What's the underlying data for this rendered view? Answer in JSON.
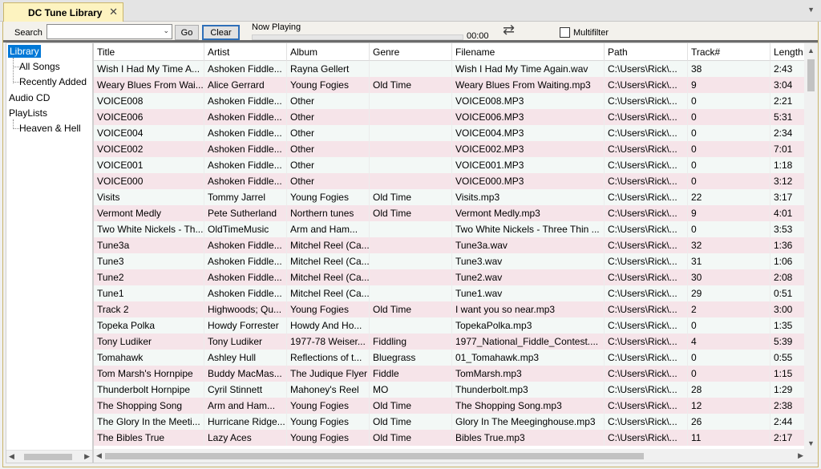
{
  "tab": {
    "title": "DC Tune Library",
    "close": "✕"
  },
  "toolbar": {
    "search_label": "Search",
    "search_value": "",
    "go_label": "Go",
    "clear_label": "Clear",
    "now_playing_label": "Now Playing",
    "progress": 0,
    "time": "00:00",
    "multifilter_label": "Multifilter",
    "multifilter_checked": false
  },
  "tree": {
    "library": "Library",
    "all_songs": "All Songs",
    "recently_added": "Recently Added",
    "audio_cd": "Audio CD",
    "playlists": "PlayLists",
    "heaven_hell": "Heaven & Hell"
  },
  "table": {
    "columns": [
      "Title",
      "Artist",
      "Album",
      "Genre",
      "Filename",
      "Path",
      "Track#",
      "Length"
    ],
    "rows": [
      [
        "Wish I Had My Time A...",
        "Ashoken Fiddle...",
        "Rayna Gellert",
        "",
        "Wish I Had My Time Again.wav",
        "C:\\Users\\Rick\\...",
        "38",
        "2:43"
      ],
      [
        "Weary Blues From Wai...",
        "Alice Gerrard",
        "Young Fogies",
        "Old Time",
        "Weary Blues From Waiting.mp3",
        "C:\\Users\\Rick\\...",
        "9",
        "3:04"
      ],
      [
        "VOICE008",
        "Ashoken Fiddle...",
        "Other",
        "",
        "VOICE008.MP3",
        "C:\\Users\\Rick\\...",
        "0",
        "2:21"
      ],
      [
        "VOICE006",
        "Ashoken Fiddle...",
        "Other",
        "",
        "VOICE006.MP3",
        "C:\\Users\\Rick\\...",
        "0",
        "5:31"
      ],
      [
        "VOICE004",
        "Ashoken Fiddle...",
        "Other",
        "",
        "VOICE004.MP3",
        "C:\\Users\\Rick\\...",
        "0",
        "2:34"
      ],
      [
        "VOICE002",
        "Ashoken Fiddle...",
        "Other",
        "",
        "VOICE002.MP3",
        "C:\\Users\\Rick\\...",
        "0",
        "7:01"
      ],
      [
        "VOICE001",
        "Ashoken Fiddle...",
        "Other",
        "",
        "VOICE001.MP3",
        "C:\\Users\\Rick\\...",
        "0",
        "1:18"
      ],
      [
        "VOICE000",
        "Ashoken Fiddle...",
        "Other",
        "",
        "VOICE000.MP3",
        "C:\\Users\\Rick\\...",
        "0",
        "3:12"
      ],
      [
        "Visits",
        "Tommy Jarrel",
        "Young Fogies",
        "Old Time",
        "Visits.mp3",
        "C:\\Users\\Rick\\...",
        "22",
        "3:17"
      ],
      [
        "Vermont Medly",
        "Pete Sutherland",
        "Northern tunes",
        "Old Time",
        "Vermont Medly.mp3",
        "C:\\Users\\Rick\\...",
        "9",
        "4:01"
      ],
      [
        "Two White Nickels - Th...",
        "OldTimeMusic",
        "Arm and Ham...",
        "",
        "Two White Nickels - Three Thin ...",
        "C:\\Users\\Rick\\...",
        "0",
        "3:53"
      ],
      [
        "Tune3a",
        "Ashoken Fiddle...",
        "Mitchel Reel (Ca...",
        "",
        "Tune3a.wav",
        "C:\\Users\\Rick\\...",
        "32",
        "1:36"
      ],
      [
        "Tune3",
        "Ashoken Fiddle...",
        "Mitchel Reel (Ca...",
        "",
        "Tune3.wav",
        "C:\\Users\\Rick\\...",
        "31",
        "1:06"
      ],
      [
        "Tune2",
        "Ashoken Fiddle...",
        "Mitchel Reel (Ca...",
        "",
        "Tune2.wav",
        "C:\\Users\\Rick\\...",
        "30",
        "2:08"
      ],
      [
        "Tune1",
        "Ashoken Fiddle...",
        "Mitchel Reel (Ca...",
        "",
        "Tune1.wav",
        "C:\\Users\\Rick\\...",
        "29",
        "0:51"
      ],
      [
        "Track 2",
        "Highwoods; Qu...",
        "Young Fogies",
        "Old Time",
        "I want you so near.mp3",
        "C:\\Users\\Rick\\...",
        "2",
        "3:00"
      ],
      [
        "Topeka Polka",
        "Howdy Forrester",
        "Howdy And Ho...",
        "",
        "TopekaPolka.mp3",
        "C:\\Users\\Rick\\...",
        "0",
        "1:35"
      ],
      [
        "Tony Ludiker",
        "Tony Ludiker",
        "1977-78 Weiser...",
        "Fiddling",
        "1977_National_Fiddle_Contest....",
        "C:\\Users\\Rick\\...",
        "4",
        "5:39"
      ],
      [
        "Tomahawk",
        "Ashley Hull",
        "Reflections of t...",
        "Bluegrass",
        "01_Tomahawk.mp3",
        "C:\\Users\\Rick\\...",
        "0",
        "0:55"
      ],
      [
        "Tom Marsh's Hornpipe",
        "Buddy MacMas...",
        "The Judique Flyer",
        "Fiddle",
        "TomMarsh.mp3",
        "C:\\Users\\Rick\\...",
        "0",
        "1:15"
      ],
      [
        "Thunderbolt Hornpipe",
        "Cyril Stinnett",
        "Mahoney's Reel",
        "MO",
        "Thunderbolt.mp3",
        "C:\\Users\\Rick\\...",
        "28",
        "1:29"
      ],
      [
        "The Shopping Song",
        "Arm and Ham...",
        "Young Fogies",
        "Old Time",
        "The Shopping Song.mp3",
        "C:\\Users\\Rick\\...",
        "12",
        "2:38"
      ],
      [
        "The Glory In the Meeti...",
        "Hurricane Ridge...",
        "Young Fogies",
        "Old Time",
        "Glory In The Meeginghouse.mp3",
        "C:\\Users\\Rick\\...",
        "26",
        "2:44"
      ],
      [
        "The Bibles True",
        "Lazy Aces",
        "Young Fogies",
        "Old Time",
        "Bibles True.mp3",
        "C:\\Users\\Rick\\...",
        "11",
        "2:17"
      ]
    ]
  }
}
